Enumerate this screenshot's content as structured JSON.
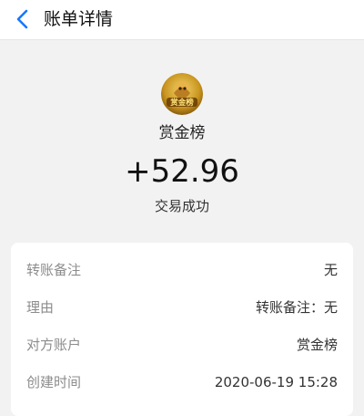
{
  "header": {
    "back_icon": "chevron-left-icon",
    "title": "账单详情"
  },
  "merchant": {
    "avatar_icon": "treasure-logo-icon",
    "logo_text": "赏金榜",
    "name": "赏金榜"
  },
  "transaction": {
    "amount": "+52.96",
    "status": "交易成功"
  },
  "details": [
    {
      "label": "转账备注",
      "value": "无"
    },
    {
      "label": "理由",
      "value": "转账备注：无"
    },
    {
      "label": "对方账户",
      "value": "赏金榜"
    },
    {
      "label": "创建时间",
      "value": "2020-06-19 15:28"
    }
  ],
  "colors": {
    "accent": "#1677ff",
    "background": "#f2f2f2",
    "card": "#ffffff",
    "label": "#8c8c8c"
  }
}
